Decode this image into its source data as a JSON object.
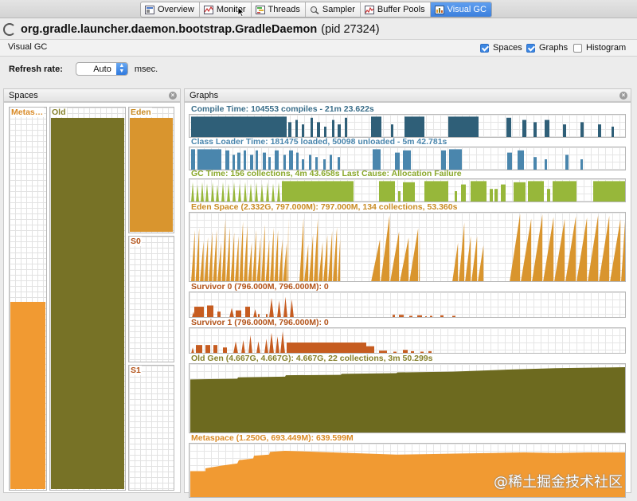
{
  "tabs": [
    {
      "label": "Overview",
      "icon": "overview-icon",
      "active": false
    },
    {
      "label": "Monitor",
      "icon": "monitor-icon",
      "active": false
    },
    {
      "label": "Threads",
      "icon": "threads-icon",
      "active": false
    },
    {
      "label": "Sampler",
      "icon": "sampler-icon",
      "active": false
    },
    {
      "label": "Buffer Pools",
      "icon": "buffer-pools-icon",
      "active": false
    },
    {
      "label": "Visual GC",
      "icon": "visual-gc-icon",
      "active": true
    }
  ],
  "header": {
    "process_name": "org.gradle.launcher.daemon.bootstrap.GradleDaemon",
    "pid_label": "(pid 27324)"
  },
  "visual_gc": {
    "label": "Visual GC",
    "toggles": [
      {
        "label": "Spaces",
        "checked": true
      },
      {
        "label": "Graphs",
        "checked": true
      },
      {
        "label": "Histogram",
        "checked": false
      }
    ]
  },
  "refresh": {
    "label": "Refresh rate:",
    "value": "Auto",
    "unit": "msec."
  },
  "spaces_panel": {
    "title": "Spaces",
    "spaces": [
      {
        "name": "Metas…",
        "fill_fraction": 0.49,
        "color": "#f19a32"
      },
      {
        "name": "Old",
        "fill_fraction": 0.995,
        "color": "#777226"
      },
      {
        "name": "Eden",
        "fill_fraction": 0.98,
        "color": "#d9952e"
      },
      {
        "name": "S0",
        "fill_fraction": 0.0,
        "color": "#c65c20"
      },
      {
        "name": "S1",
        "fill_fraction": 0.0,
        "color": "#c65c20"
      }
    ]
  },
  "graphs_panel": {
    "title": "Graphs",
    "graphs": [
      {
        "key": "compile",
        "label": "Compile Time: 104553 compiles - 21m 23.622s",
        "color": "#2f5f78",
        "label_color": "#3a6e8a"
      },
      {
        "key": "classloader",
        "label": "Class Loader Time: 181475 loaded, 50098 unloaded - 5m 42.781s",
        "color": "#4a86ad",
        "label_color": "#4a86ad"
      },
      {
        "key": "gc",
        "label": "GC Time: 156 collections, 4m 43.658s  Last Cause: Allocation Failure",
        "color": "#97b73a",
        "label_color": "#8aa82c"
      },
      {
        "key": "eden",
        "label": "Eden Space (2.332G, 797.000M): 797.000M, 134 collections, 53.360s",
        "color": "#d9952e",
        "label_color": "#c98b24"
      },
      {
        "key": "s0",
        "label": "Survivor 0 (796.000M, 796.000M): 0",
        "color": "#c65c20",
        "label_color": "#b25218"
      },
      {
        "key": "s1",
        "label": "Survivor 1 (796.000M, 796.000M): 0",
        "color": "#c65c20",
        "label_color": "#b25218"
      },
      {
        "key": "old",
        "label": "Old Gen (4.667G, 4.667G): 4.667G, 22 collections, 3m 50.299s",
        "color": "#6d6a1f",
        "label_color": "#85802a"
      },
      {
        "key": "meta",
        "label": "Metaspace (1.250G, 693.449M): 639.599M",
        "color": "#f19a32",
        "label_color": "#d98a26"
      }
    ]
  },
  "watermark": "@稀土掘金技术社区"
}
